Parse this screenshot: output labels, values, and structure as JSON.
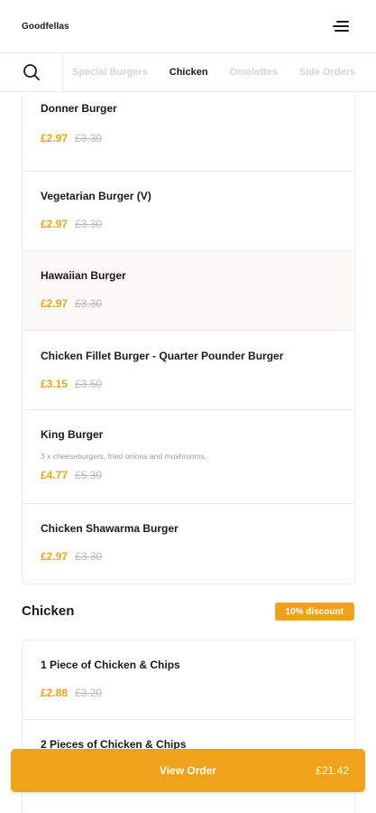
{
  "header": {
    "brand": "Goodfellas"
  },
  "categories": {
    "tabs": [
      {
        "label": "Special Burgers",
        "active": false
      },
      {
        "label": "Chicken",
        "active": true
      },
      {
        "label": "Omelettes",
        "active": false
      },
      {
        "label": "Side Orders",
        "active": false
      }
    ]
  },
  "burgers": {
    "items": [
      {
        "name": "Donner Burger",
        "price": "£2.97",
        "old_price": "£3.30"
      },
      {
        "name": "Vegetarian Burger (V)",
        "price": "£2.97",
        "old_price": "£3.30"
      },
      {
        "name": "Hawaiian Burger",
        "price": "£2.97",
        "old_price": "£3.30"
      },
      {
        "name": "Chicken Fillet Burger - Quarter Pounder Burger",
        "price": "£3.15",
        "old_price": "£3.50"
      },
      {
        "name": "King Burger",
        "description": "3 x cheeseburgers, fried onions and mushrooms.",
        "price": "£4.77",
        "old_price": "£5.30"
      },
      {
        "name": "Chicken Shawarma Burger",
        "price": "£2.97",
        "old_price": "£3.30"
      }
    ]
  },
  "chicken": {
    "title": "Chicken",
    "badge": "10% discount",
    "items": [
      {
        "name": "1 Piece of Chicken & Chips",
        "price": "£2.88",
        "old_price": "£3.20"
      },
      {
        "name": "2 Pieces of Chicken & Chips"
      }
    ]
  },
  "order": {
    "label": "View Order",
    "total": "£21.42"
  },
  "colors": {
    "accent": "#f0a21b",
    "muted": "#b9b9b9",
    "highlight_row": "#fbfaf6"
  }
}
